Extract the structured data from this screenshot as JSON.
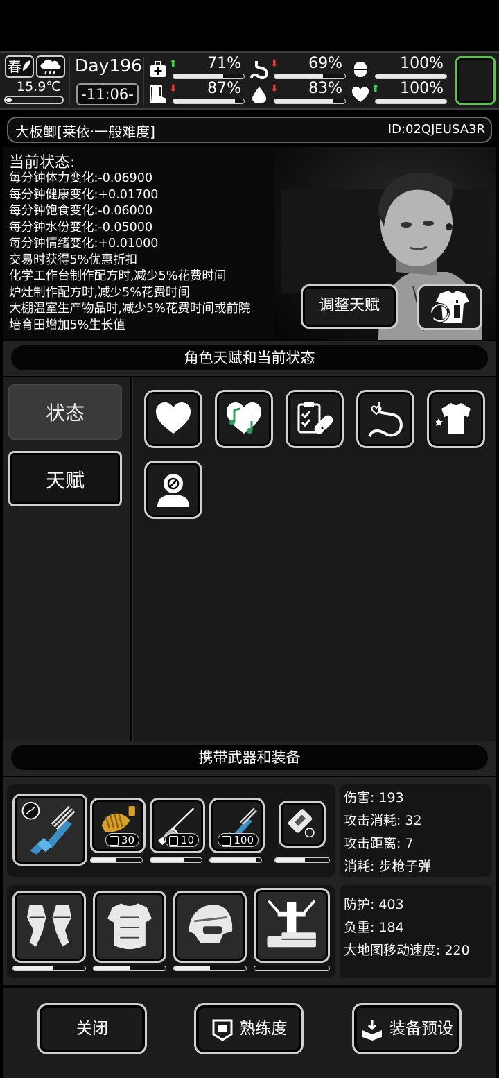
{
  "hud": {
    "season": "春",
    "temperature": "15.9℃",
    "day": "Day196",
    "time": "-11:06-",
    "stats": [
      {
        "icon": "medkit-icon",
        "trend": "up",
        "value": "71%",
        "fill": 0.71
      },
      {
        "icon": "stomach-icon",
        "trend": "down",
        "value": "69%",
        "fill": 0.69
      },
      {
        "icon": "brain-icon",
        "trend": "none",
        "value": "100%",
        "fill": 1.0
      },
      {
        "icon": "boot-icon",
        "trend": "down",
        "value": "87%",
        "fill": 0.87
      },
      {
        "icon": "water-drop-icon",
        "trend": "down",
        "value": "83%",
        "fill": 0.83
      },
      {
        "icon": "heart-icon",
        "trend": "up",
        "value": "100%",
        "fill": 1.0
      }
    ],
    "colors": {
      "up": "#3ecf4a",
      "down": "#e23b3b",
      "highlight": "#5bc24b"
    }
  },
  "character": {
    "name": "大板鲫[莱依·一般难度]",
    "id": "ID:02QJEUSA3R",
    "status_title": "当前状态:",
    "status_lines": [
      "每分钟体力变化:-0.06900",
      "每分钟健康变化:+0.01700",
      "每分钟饱食变化:-0.06000",
      "每分钟水份变化:-0.05000",
      "每分钟情绪变化:+0.01000",
      "交易时获得5%优惠折扣",
      "化学工作台制作配方时,减少5%花费时间",
      "炉灶制作配方时,减少5%花费时间",
      "大棚温室生产物品时,减少5%花费时间或前院",
      "培育田增加5%生长值"
    ],
    "adjust_talent_label": "调整天赋"
  },
  "sections": {
    "talents_title": "角色天赋和当前状态",
    "equipment_title": "携带武器和装备"
  },
  "tabs": [
    {
      "label": "状态",
      "active": true
    },
    {
      "label": "天赋",
      "active": false
    }
  ],
  "status_icons": [
    "heart-icon",
    "music-heart-icon",
    "clipboard-pill-icon",
    "stomach-heart-icon",
    "shirt-icon",
    "head-no-sign-icon"
  ],
  "weapons": {
    "slots": [
      {
        "icon": "minigun-icon",
        "selected": true,
        "durability": 0.8
      },
      {
        "icon": "ammo-belt-icon",
        "ammo": "30",
        "durability": 0.5
      },
      {
        "icon": "rifle-icon",
        "ammo": "10",
        "durability": 0.65
      },
      {
        "icon": "minigun-icon",
        "ammo": "100",
        "durability": 0.9
      },
      {
        "icon": "battery-icon",
        "durability": 0.55
      }
    ],
    "stats": [
      "伤害: 193",
      "攻击消耗: 32",
      "攻击距离: 7",
      "消耗: 步枪子弹"
    ]
  },
  "armor": {
    "slots": [
      {
        "icon": "gauntlets-icon",
        "durability": 0.55
      },
      {
        "icon": "body-armor-icon",
        "durability": 0.5
      },
      {
        "icon": "helmet-icon",
        "durability": 0.5
      },
      {
        "icon": "backpack-frame-icon",
        "durability": 0
      }
    ],
    "stats": [
      "防护: 403",
      "负重: 184",
      "大地图移动速度: 220"
    ]
  },
  "footer": {
    "close": "关闭",
    "proficiency": "熟练度",
    "preset": "装备预设"
  }
}
